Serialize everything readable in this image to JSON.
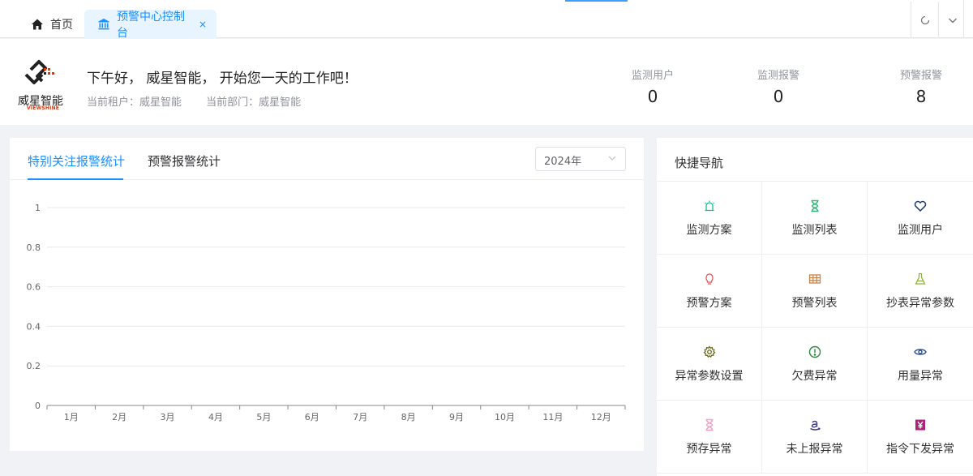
{
  "tabs": {
    "home_label": "首页",
    "active_label": "预警中心控制台",
    "close_glyph": "×"
  },
  "header": {
    "greeting": "下午好， 威星智能， 开始您一天的工作吧！",
    "tenant": "当前租户：威星智能",
    "department": "当前部门：威星智能",
    "logo_cn": "威星智能",
    "logo_en": "VIEWSHINE",
    "stats": [
      {
        "label": "监测用户",
        "value": "0"
      },
      {
        "label": "监测报警",
        "value": "0"
      },
      {
        "label": "预警报警",
        "value": "8"
      }
    ]
  },
  "chart_panel": {
    "tabs": [
      "特别关注报警统计",
      "预警报警统计"
    ],
    "active_tab": 0,
    "year": "2024年"
  },
  "chart_data": {
    "type": "bar",
    "categories": [
      "1月",
      "2月",
      "3月",
      "4月",
      "5月",
      "6月",
      "7月",
      "8月",
      "9月",
      "10月",
      "11月",
      "12月"
    ],
    "series": [
      {
        "values": [
          0,
          0,
          0,
          0,
          0,
          0,
          0,
          0,
          0,
          0,
          0,
          0
        ]
      }
    ],
    "yticks": [
      "0",
      "0.2",
      "0.4",
      "0.6",
      "0.8",
      "1"
    ],
    "ylim": [
      0,
      1
    ],
    "grid": true
  },
  "quick_nav": {
    "title": "快捷导航",
    "items": [
      {
        "label": "监测方案",
        "icon": "alarm-light-icon",
        "color": "#19be9b"
      },
      {
        "label": "监测列表",
        "icon": "hourglass-icon",
        "color": "#2bb673"
      },
      {
        "label": "监测用户",
        "icon": "heart-icon",
        "color": "#1f3b6e"
      },
      {
        "label": "预警方案",
        "icon": "lightbulb-icon",
        "color": "#e05a5a"
      },
      {
        "label": "预警列表",
        "icon": "table-icon",
        "color": "#c9864b"
      },
      {
        "label": "抄表异常参数",
        "icon": "flask-icon",
        "color": "#8fb23a"
      },
      {
        "label": "异常参数设置",
        "icon": "gear-icon",
        "color": "#6b6b1e"
      },
      {
        "label": "欠费异常",
        "icon": "exclamation-circle-icon",
        "color": "#2b8a3e"
      },
      {
        "label": "用量异常",
        "icon": "eye-icon",
        "color": "#2f4f8f"
      },
      {
        "label": "预存异常",
        "icon": "hourglass-icon",
        "color": "#f2a0c4"
      },
      {
        "label": "未上报异常",
        "icon": "amazon-icon",
        "color": "#3b3b9a"
      },
      {
        "label": "指令下发异常",
        "icon": "yen-box-icon",
        "color": "#b0207a"
      }
    ]
  }
}
